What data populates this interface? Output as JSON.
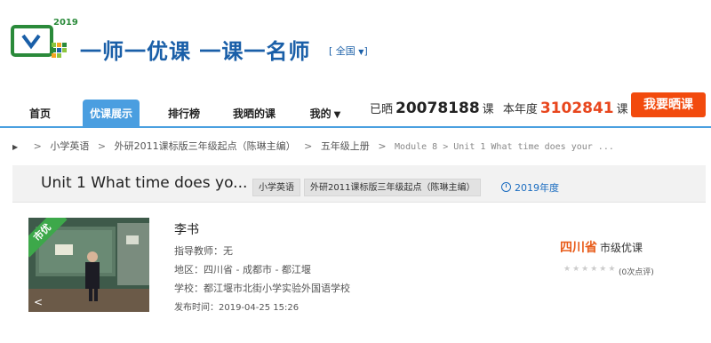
{
  "header": {
    "logo_year": "2019",
    "slogan": "一师一优课 一课一名师",
    "region": "全国"
  },
  "nav": {
    "tabs": [
      {
        "label": "首页"
      },
      {
        "label": "优课展示"
      },
      {
        "label": "排行榜"
      },
      {
        "label": "我晒的课"
      },
      {
        "label": "我的"
      }
    ],
    "active_tab": "优课展示"
  },
  "stats": {
    "shared_label": "已晒",
    "shared_count": "20078188",
    "shared_unit": "课",
    "year_label": "本年度",
    "year_count": "3102841",
    "year_unit": "课"
  },
  "share_button": "我要晒课",
  "breadcrumb": {
    "items": [
      "小学英语",
      "外研2011课标版三年级起点（陈琳主编）",
      "五年级上册"
    ],
    "current": "Module 8 > Unit 1 What time does your ..."
  },
  "course": {
    "title": "Unit 1 What time does yo...",
    "tags": [
      "小学英语",
      "外研2011课标版三年级起点（陈琳主编）"
    ],
    "year": "2019年度",
    "badge": "市优",
    "teacher": "李书",
    "advisor": "指导教师：无",
    "region": "地区：四川省 - 成都市 - 都江堰",
    "school": "学校：都江堰市北街小学实验外国语学校",
    "published": "发布时间：2019-04-25 15:26",
    "province": "四川省",
    "level": "市级优课",
    "stars": "★★★★★★",
    "reviews": "(0次点评)"
  },
  "colors": {
    "brand_blue": "#1a5fa8",
    "nav_active": "#4a9ee0",
    "cta_orange": "#f24a0d",
    "badge_green": "#3da84a",
    "highlight_red": "#e8461d"
  }
}
